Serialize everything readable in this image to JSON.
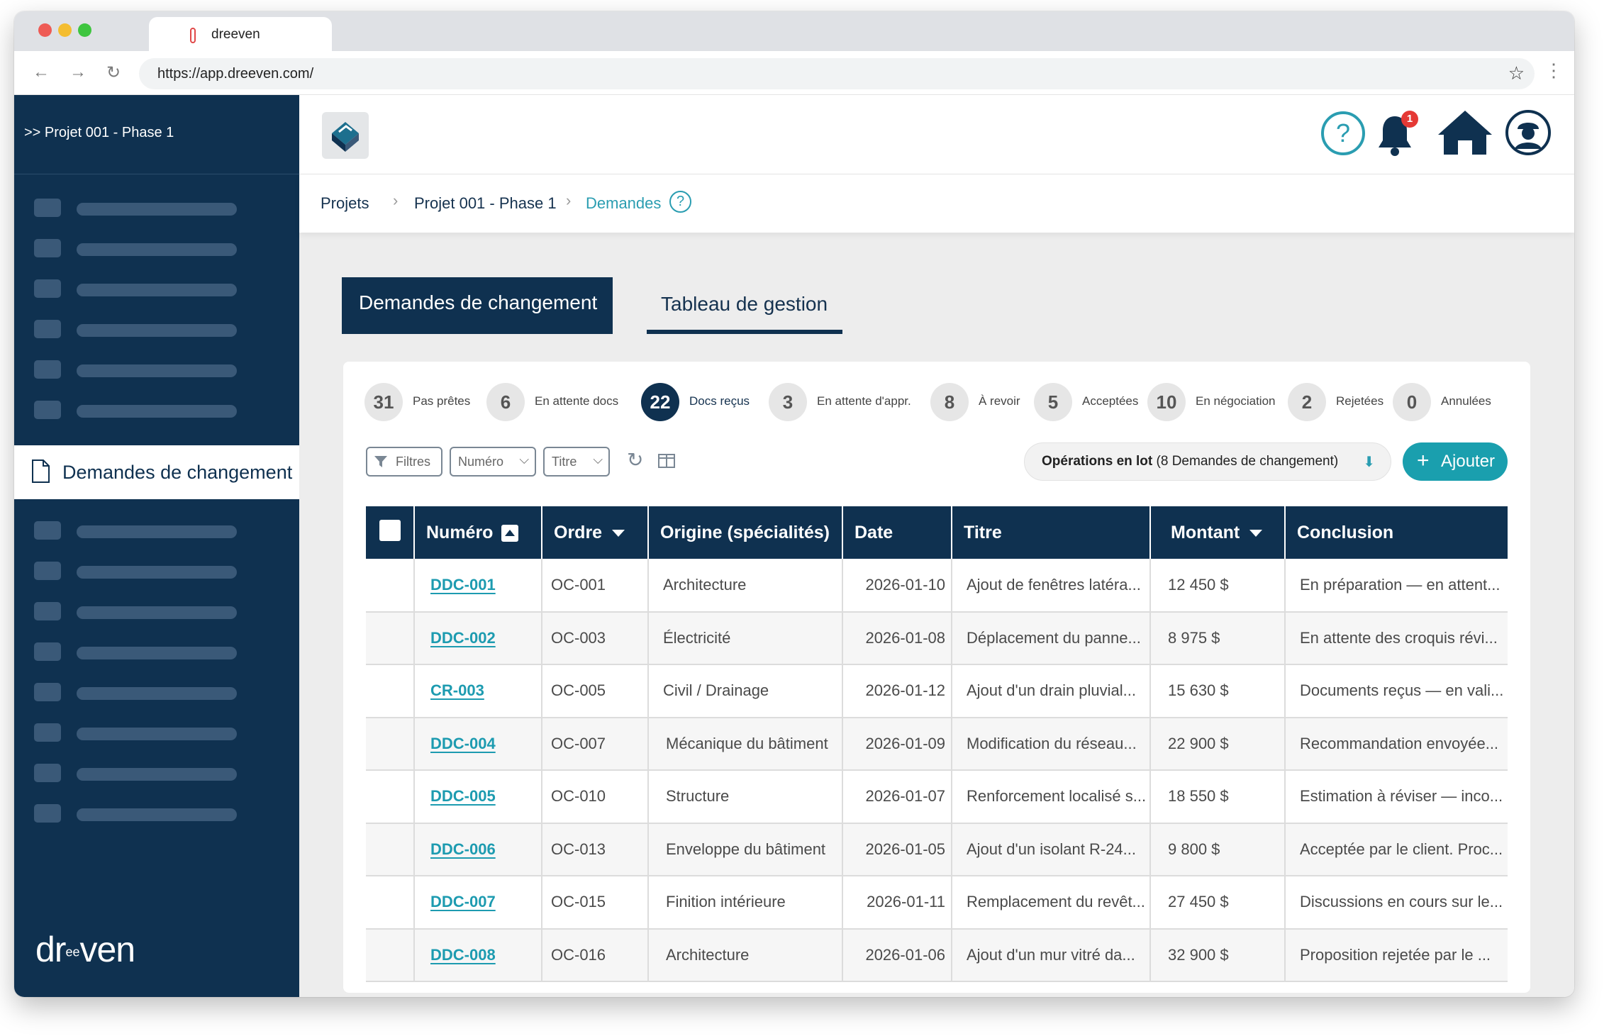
{
  "browser": {
    "tab_title": "dreeven",
    "url": "https://app.dreeven.com/"
  },
  "sidebar": {
    "project": ">> Projet 001 - Phase 1",
    "active_item": "Demandes de changement",
    "logo": "dr  ven"
  },
  "header": {
    "notification_count": "1",
    "icons": [
      "help-icon",
      "bell-icon",
      "home-icon",
      "user-avatar-icon"
    ]
  },
  "breadcrumb": {
    "items": [
      "Projets",
      "Projet 001 - Phase 1",
      "Demandes"
    ],
    "help": "?"
  },
  "tabs": [
    {
      "label": "Demandes de changement",
      "active": true
    },
    {
      "label": "Tableau de gestion",
      "active": false
    }
  ],
  "stats": [
    {
      "count": "31",
      "label": "Pas prêtes"
    },
    {
      "count": "6",
      "label": "En attente docs"
    },
    {
      "count": "22",
      "label": "Docs reçus",
      "active": true
    },
    {
      "count": "3",
      "label": "En attente d'appr."
    },
    {
      "count": "8",
      "label": "À revoir"
    },
    {
      "count": "5",
      "label": "Acceptées"
    },
    {
      "count": "10",
      "label": "En négociation"
    },
    {
      "count": "2",
      "label": "Rejetées"
    },
    {
      "count": "0",
      "label": "Annulées"
    }
  ],
  "toolbar": {
    "filters": "Filtres",
    "numero_select": "Numéro",
    "titre_select": "Titre",
    "batch_bold": "Opérations en lot",
    "batch_rest": " (8 Demandes de changement)",
    "add": "Ajouter"
  },
  "table": {
    "columns": [
      "Numéro",
      "Ordre",
      "Origine (spécialités)",
      "Date",
      "Titre",
      "Montant",
      "Conclusion"
    ],
    "rows": [
      {
        "numero": "DDC-001",
        "ordre": "OC-001",
        "origine": "Architecture",
        "date": "2026-01-10",
        "titre": "Ajout de fenêtres latéra...",
        "montant": "12 450 $",
        "conclusion": "En préparation — en attent..."
      },
      {
        "numero": "DDC-002",
        "ordre": "OC-003",
        "origine": "Électricité",
        "date": "2026-01-08",
        "titre": "Déplacement du panne...",
        "montant": "8 975 $",
        "conclusion": "En attente des croquis révi..."
      },
      {
        "numero": "CR-003",
        "ordre": "OC-005",
        "origine": "Civil / Drainage",
        "date": "2026-01-12",
        "titre": "Ajout d'un drain pluvial...",
        "montant": "15 630 $",
        "conclusion": "Documents reçus — en vali..."
      },
      {
        "numero": "DDC-004",
        "ordre": "OC-007",
        "origine": "Mécanique du bâtiment",
        "date": "2026-01-09",
        "titre": "Modification du réseau...",
        "montant": "22 900 $",
        "conclusion": "Recommandation envoyée..."
      },
      {
        "numero": "DDC-005",
        "ordre": "OC-010",
        "origine": "Structure",
        "date": "2026-01-07",
        "titre": "Renforcement localisé s...",
        "montant": "18 550 $",
        "conclusion": "Estimation à réviser — inco..."
      },
      {
        "numero": "DDC-006",
        "ordre": "OC-013",
        "origine": "Enveloppe du bâtiment",
        "date": "2026-01-05",
        "titre": "Ajout d'un isolant R-24...",
        "montant": "9 800 $",
        "conclusion": "Acceptée par le client. Proc..."
      },
      {
        "numero": "DDC-007",
        "ordre": "OC-015",
        "origine": "Finition intérieure",
        "date": "2026-01-11",
        "titre": "Remplacement du revêt...",
        "montant": "27 450 $",
        "conclusion": "Discussions en cours sur le..."
      },
      {
        "numero": "DDC-008",
        "ordre": "OC-016",
        "origine": "Architecture",
        "date": "2026-01-06",
        "titre": "Ajout d'un mur vitré da...",
        "montant": "32 900 $",
        "conclusion": "Proposition rejetée par le ..."
      }
    ]
  },
  "colors": {
    "navy": "#0f3150",
    "teal": "#1a9fae",
    "badge": "#e53935"
  }
}
